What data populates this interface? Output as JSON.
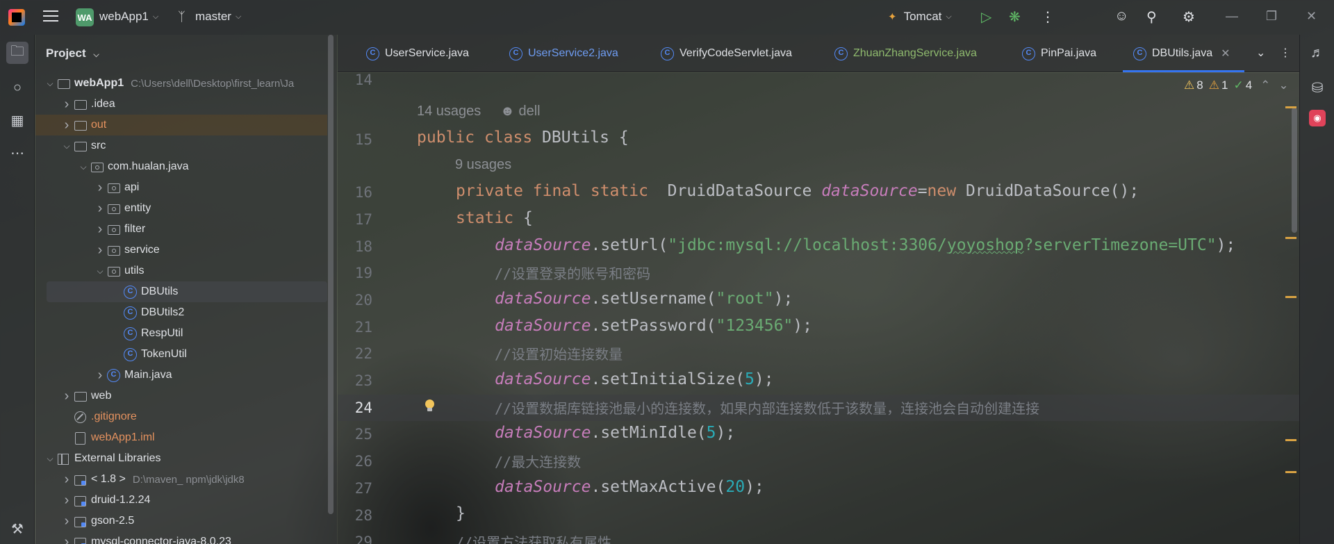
{
  "titlebar": {
    "project_initials": "WA",
    "project_name": "webApp1",
    "branch": "master",
    "run_config": "Tomcat"
  },
  "project_panel": {
    "title": "Project",
    "tree": [
      {
        "label": "webApp1",
        "meta": "C:\\Users\\dell\\Desktop\\first_learn\\Ja",
        "depth": 0,
        "expanded": true,
        "icon": "folder",
        "bold": true
      },
      {
        "label": ".idea",
        "depth": 1,
        "expanded": false,
        "icon": "folder"
      },
      {
        "label": "out",
        "depth": 1,
        "expanded": false,
        "icon": "folder",
        "color": "orange"
      },
      {
        "label": "src",
        "depth": 1,
        "expanded": true,
        "icon": "folder"
      },
      {
        "label": "com.hualan.java",
        "depth": 2,
        "expanded": true,
        "icon": "pkg"
      },
      {
        "label": "api",
        "depth": 3,
        "expanded": false,
        "icon": "pkg"
      },
      {
        "label": "entity",
        "depth": 3,
        "expanded": false,
        "icon": "pkg"
      },
      {
        "label": "filter",
        "depth": 3,
        "expanded": false,
        "icon": "pkg"
      },
      {
        "label": "service",
        "depth": 3,
        "expanded": false,
        "icon": "pkg"
      },
      {
        "label": "utils",
        "depth": 3,
        "expanded": true,
        "icon": "pkg"
      },
      {
        "label": "DBUtils",
        "depth": 4,
        "icon": "cls",
        "selected": true
      },
      {
        "label": "DBUtils2",
        "depth": 4,
        "icon": "cls"
      },
      {
        "label": "RespUtil",
        "depth": 4,
        "icon": "cls"
      },
      {
        "label": "TokenUtil",
        "depth": 4,
        "icon": "cls"
      },
      {
        "label": "Main.java",
        "depth": 3,
        "expanded": false,
        "icon": "cls"
      },
      {
        "label": "web",
        "depth": 1,
        "expanded": false,
        "icon": "folder"
      },
      {
        "label": ".gitignore",
        "depth": 1,
        "icon": "ignore",
        "color": "orange"
      },
      {
        "label": "webApp1.iml",
        "depth": 1,
        "icon": "iml",
        "color": "orange"
      },
      {
        "label": "External Libraries",
        "depth": 0,
        "expanded": true,
        "icon": "lib"
      },
      {
        "label": "< 1.8 >",
        "meta": "D:\\maven_ npm\\jdk\\jdk8",
        "depth": 1,
        "expanded": false,
        "icon": "jar"
      },
      {
        "label": "druid-1.2.24",
        "depth": 1,
        "expanded": false,
        "icon": "jar"
      },
      {
        "label": "gson-2.5",
        "depth": 1,
        "expanded": false,
        "icon": "jar"
      },
      {
        "label": "mysql-connector-java-8.0.23",
        "depth": 1,
        "expanded": false,
        "icon": "jar"
      }
    ]
  },
  "tabs": [
    {
      "label": "UserService.java",
      "style": "normal"
    },
    {
      "label": "UserService2.java",
      "style": "blue"
    },
    {
      "label": "VerifyCodeServlet.java",
      "style": "normal"
    },
    {
      "label": "ZhuanZhangService.java",
      "style": "green"
    },
    {
      "label": "PinPai.java",
      "style": "normal"
    },
    {
      "label": "DBUtils.java",
      "style": "active"
    }
  ],
  "inspections": {
    "warnings": "8",
    "weak_warnings": "1",
    "typos": "4"
  },
  "editor": {
    "current_line": "24",
    "inlay_usages_class": "14 usages",
    "inlay_author": "dell",
    "inlay_usages_field": "9 usages",
    "line_numbers": [
      "14",
      "15",
      "16",
      "17",
      "18",
      "19",
      "20",
      "21",
      "22",
      "23",
      "24",
      "25",
      "26",
      "27",
      "28",
      "29"
    ],
    "code": {
      "l15_kw1": "public",
      "l15_kw2": "class",
      "l15_rest": " DBUtils {",
      "l16_kw": "private final static",
      "l16_type": "  DruidDataSource ",
      "l16_field": "dataSource",
      "l16_eq": "=",
      "l16_new": "new",
      "l16_rest": " DruidDataSource();",
      "l17_kw": "static",
      "l17_rest": " {",
      "field": "dataSource",
      "l18_call": ".setUrl(",
      "l18_str1": "\"jdbc:mysql://localhost:3306/",
      "l18_str2": "yoyoshop",
      "l18_str3": "?serverTimezone=UTC\"",
      "l18_end": ");",
      "l19_cmt": "//设置登录的账号和密码",
      "l20_call": ".setUsername(",
      "l20_str": "\"root\"",
      "l20_end": ");",
      "l21_call": ".setPassword(",
      "l21_str": "\"123456\"",
      "l21_end": ");",
      "l22_cmt": "//设置初始连接数量",
      "l23_call": ".setInitialSize(",
      "l23_num": "5",
      "l23_end": ");",
      "l24_cmt": "//设置数据库链接池最小的连接数，如果内部连接数低于该数量，连接池会自动创建连接",
      "l25_call": ".setMinIdle(",
      "l25_num": "5",
      "l25_end": ");",
      "l26_cmt": "//最大连接数",
      "l27_call": ".setMaxActive(",
      "l27_num": "20",
      "l27_end": ");",
      "l28": "}",
      "l29_cmt": "//设置方法获取私有属性"
    }
  }
}
